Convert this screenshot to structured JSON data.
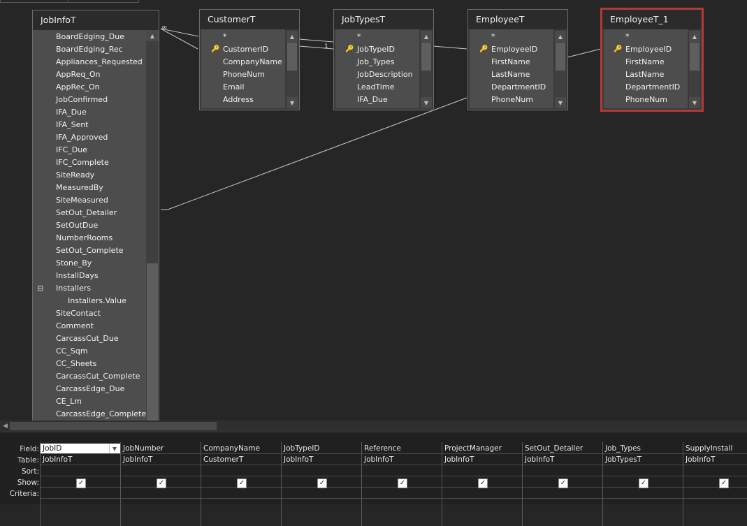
{
  "tables": [
    {
      "name": "JobInfoT",
      "selected": false,
      "fields": [
        {
          "label": "BoardEdging_Due"
        },
        {
          "label": "BoardEdging_Rec"
        },
        {
          "label": "Appliances_Requested"
        },
        {
          "label": "AppReq_On"
        },
        {
          "label": "AppRec_On"
        },
        {
          "label": "JobConfirmed"
        },
        {
          "label": "IFA_Due"
        },
        {
          "label": "IFA_Sent"
        },
        {
          "label": "IFA_Approved"
        },
        {
          "label": "IFC_Due"
        },
        {
          "label": "IFC_Complete"
        },
        {
          "label": "SiteReady"
        },
        {
          "label": "MeasuredBy"
        },
        {
          "label": "SiteMeasured"
        },
        {
          "label": "SetOut_Detailer"
        },
        {
          "label": "SetOutDue"
        },
        {
          "label": "NumberRooms"
        },
        {
          "label": "SetOut_Complete"
        },
        {
          "label": "Stone_By"
        },
        {
          "label": "InstallDays"
        },
        {
          "label": "Installers",
          "expander": "⊟"
        },
        {
          "label": "Installers.Value",
          "indent": true
        },
        {
          "label": "SiteContact"
        },
        {
          "label": "Comment"
        },
        {
          "label": "CarcassCut_Due"
        },
        {
          "label": "CC_Sqm"
        },
        {
          "label": "CC_Sheets"
        },
        {
          "label": "CarcassCut_Complete"
        },
        {
          "label": "CarcassEdge_Due"
        },
        {
          "label": "CE_Lm"
        },
        {
          "label": "CarcassEdge_Complete"
        }
      ]
    },
    {
      "name": "CustomerT",
      "selected": false,
      "fields": [
        {
          "label": "*"
        },
        {
          "label": "CustomerID",
          "key": true
        },
        {
          "label": "CompanyName"
        },
        {
          "label": "PhoneNum"
        },
        {
          "label": "Email"
        },
        {
          "label": "Address"
        }
      ]
    },
    {
      "name": "JobTypesT",
      "selected": false,
      "fields": [
        {
          "label": "*"
        },
        {
          "label": "JobTypeID",
          "key": true
        },
        {
          "label": "Job_Types"
        },
        {
          "label": "JobDescription"
        },
        {
          "label": "LeadTime"
        },
        {
          "label": "IFA_Due"
        }
      ]
    },
    {
      "name": "EmployeeT",
      "selected": false,
      "fields": [
        {
          "label": "*"
        },
        {
          "label": "EmployeeID",
          "key": true
        },
        {
          "label": "FirstName"
        },
        {
          "label": "LastName"
        },
        {
          "label": "DepartmentID"
        },
        {
          "label": "PhoneNum"
        }
      ]
    },
    {
      "name": "EmployeeT_1",
      "selected": true,
      "fields": [
        {
          "label": "*"
        },
        {
          "label": "EmployeeID",
          "key": true
        },
        {
          "label": "FirstName"
        },
        {
          "label": "LastName"
        },
        {
          "label": "DepartmentID"
        },
        {
          "label": "PhoneNum"
        }
      ]
    }
  ],
  "relationships": [
    {
      "from": "JobInfoT",
      "to": "CustomerT",
      "many_symbol": "∞",
      "one_symbol": "1"
    },
    {
      "from": "CustomerT",
      "to": "JobTypesT"
    },
    {
      "from": "JobTypesT",
      "to": "EmployeeT"
    },
    {
      "from": "EmployeeT",
      "to": "EmployeeT_1"
    },
    {
      "from": "EmployeeT",
      "to": "JobInfoT"
    }
  ],
  "design_grid": {
    "row_labels": {
      "field": "Field:",
      "table": "Table:",
      "sort": "Sort:",
      "show": "Show:",
      "criteria": "Criteria:"
    },
    "dropdown_icon": "chevron-down-icon",
    "columns": [
      {
        "field": "JobID",
        "table": "JobInfoT",
        "show": true,
        "active": true
      },
      {
        "field": "JobNumber",
        "table": "JobInfoT",
        "show": true
      },
      {
        "field": "CompanyName",
        "table": "CustomerT",
        "show": true
      },
      {
        "field": "JobTypeID",
        "table": "JobInfoT",
        "show": true
      },
      {
        "field": "Reference",
        "table": "JobInfoT",
        "show": true
      },
      {
        "field": "ProjectManager",
        "table": "JobInfoT",
        "show": true
      },
      {
        "field": "SetOut_Detailer",
        "table": "JobInfoT",
        "show": true
      },
      {
        "field": "Job_Types",
        "table": "JobTypesT",
        "show": true
      },
      {
        "field": "SupplyInstall",
        "table": "JobInfoT",
        "show": true
      }
    ]
  },
  "colors": {
    "background": "#262626",
    "field_list": "#4d4d4d",
    "selected_border": "#b13a3a",
    "line": "#c9c9c9"
  }
}
